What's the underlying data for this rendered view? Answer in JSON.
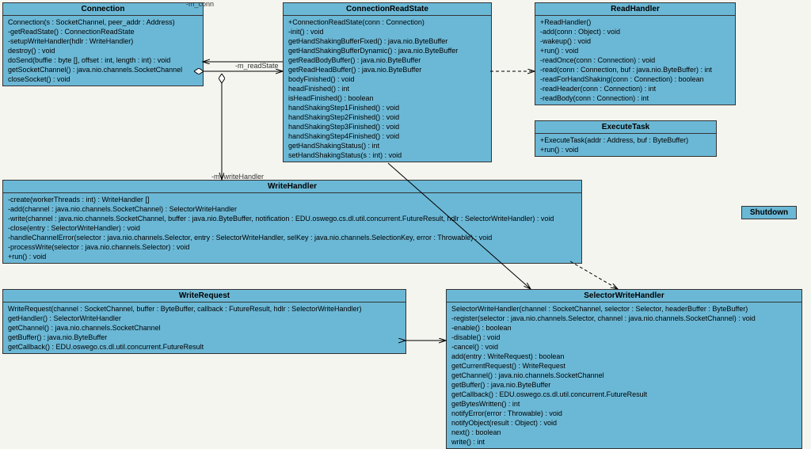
{
  "classes": {
    "Connection": {
      "title": "Connection",
      "methods": [
        "Connection(s : SocketChannel, peer_addr : Address)",
        "-getReadState() : ConnectionReadState",
        "-setupWriteHandler(hdlr : WriteHandler)",
        "destroy() : void",
        "doSend(buffie : byte [], offset : int, length : int) : void",
        "getSocketChannel() : java.nio.channels.SocketChannel",
        "closeSocket() : void"
      ]
    },
    "ConnectionReadState": {
      "title": "ConnectionReadState",
      "methods": [
        "+ConnectionReadState(conn : Connection)",
        "-init() : void",
        "getHandShakingBufferFixed() : java.nio.ByteBuffer",
        "getHandShakingBufferDynamic() : java.nio.ByteBuffer",
        "getReadBodyBuffer() : java.nio.ByteBuffer",
        "getReadHeadBuffer() : java.nio.ByteBuffer",
        "bodyFinished() : void",
        "headFinished() : int",
        "isHeadFinished() : boolean",
        "handShakingStep1Finished() : void",
        "handShakingStep2Finished() : void",
        "handShakingStep3Finished() : void",
        "handShakingStep4Finished() : void",
        "getHandShakingStatus() : int",
        "setHandShakingStatus(s : int) : void"
      ]
    },
    "ReadHandler": {
      "title": "ReadHandler",
      "methods": [
        "+ReadHandler()",
        "-add(conn : Object) : void",
        "-wakeup() : void",
        "+run() : void",
        "-readOnce(conn : Connection) : void",
        "-read(conn : Connection, buf : java.nio.ByteBuffer) : int",
        "-readForHandShaking(conn : Connection) : boolean",
        "-readHeader(conn : Connection) : int",
        "-readBody(conn : Connection) : int"
      ]
    },
    "ExecuteTask": {
      "title": "ExecuteTask",
      "methods": [
        "+ExecuteTask(addr : Address, buf : ByteBuffer)",
        "+run() : void"
      ]
    },
    "WriteHandler": {
      "title": "WriteHandler",
      "methods": [
        "-create(workerThreads : int) : WriteHandler []",
        "-add(channel : java.nio.channels.SocketChannel) : SelectorWriteHandler",
        "-write(channel : java.nio.channels.SocketChannel, buffer : java.nio.ByteBuffer, notification : EDU.oswego.cs.dl.util.concurrent.FutureResult, hdlr : SelectorWriteHandler) : void",
        "-close(entry : SelectorWriteHandler) : void",
        "-handleChannelError(selector : java.nio.channels.Selector, entry : SelectorWriteHandler, selKey : java.nio.channels.SelectionKey, error : Throwable) : void",
        "-processWrite(selector : java.nio.channels.Selector) : void",
        "+run() : void"
      ]
    },
    "Shutdown": {
      "title": "Shutdown",
      "methods": []
    },
    "WriteRequest": {
      "title": "WriteRequest",
      "methods": [
        "WriteRequest(channel : SocketChannel, buffer : ByteBuffer, callback : FutureResult, hdlr : SelectorWriteHandler)",
        "getHandler() : SelectorWriteHandler",
        "getChannel() : java.nio.channels.SocketChannel",
        "getBuffer() : java.nio.ByteBuffer",
        "getCallback() : EDU.oswego.cs.dl.util.concurrent.FutureResult"
      ]
    },
    "SelectorWriteHandler": {
      "title": "SelectorWriteHandler",
      "methods": [
        "SelectorWriteHandler(channel : SocketChannel, selector : Selector, headerBuffer : ByteBuffer)",
        "-register(selector : java.nio.channels.Selector, channel : java.nio.channels.SocketChannel) : void",
        "-enable() : boolean",
        "-disable() : void",
        "-cancel() : void",
        "add(entry : WriteRequest) : boolean",
        "getCurrentRequest() : WriteRequest",
        "getChannel() : java.nio.channels.SocketChannel",
        "getBuffer() : java.nio.ByteBuffer",
        "getCallback() : EDU.oswego.cs.dl.util.concurrent.FutureResult",
        "getBytesWritten() : int",
        "notifyError(error : Throwable) : void",
        "notifyObject(result : Object) : void",
        "next() : boolean",
        "write() : int"
      ]
    }
  },
  "labels": {
    "m_conn": "-m_conn",
    "m_readState": "-m_readState",
    "m_writeHandler": "-m_writeHandler"
  }
}
